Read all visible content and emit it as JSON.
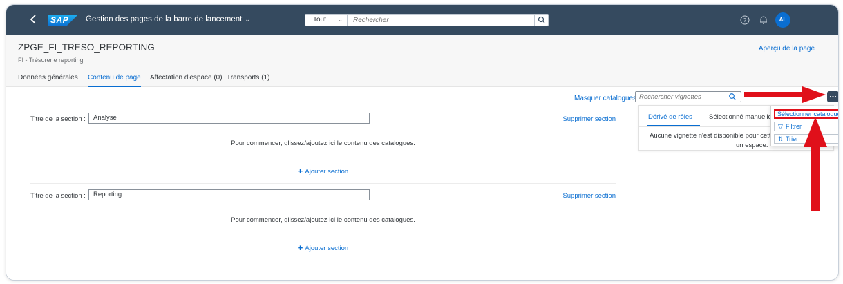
{
  "shell": {
    "logo_text": "SAP",
    "app_title": "Gestion des pages de la barre de lancement",
    "search_scope": "Tout",
    "search_placeholder": "Rechercher",
    "avatar_initials": "AL"
  },
  "header": {
    "title": "ZPGE_FI_TRESO_REPORTING",
    "subtitle": "FI - Trésorerie reporting",
    "preview_link": "Aperçu de la page",
    "tabs": [
      {
        "label": "Données générales"
      },
      {
        "label": "Contenu de page"
      },
      {
        "label": "Affectation d'espace (0)"
      },
      {
        "label": "Transports (1)"
      }
    ]
  },
  "toolbar": {
    "hide_catalogs": "Masquer catalogues",
    "tile_search_placeholder": "Rechercher vignettes"
  },
  "sections": [
    {
      "label": "Titre de la section :",
      "title_value": "Analyse",
      "delete": "Supprimer section",
      "hint": "Pour commencer, glissez/ajoutez ici le contenu des catalogues.",
      "add": "Ajouter section"
    },
    {
      "label": "Titre de la section :",
      "title_value": "Reporting",
      "delete": "Supprimer section",
      "hint": "Pour commencer, glissez/ajoutez ici le contenu des catalogues.",
      "add": "Ajouter section"
    }
  ],
  "side_panel": {
    "tabs": [
      {
        "label": "Dérivé de rôles"
      },
      {
        "label": "Sélectionné manuellem"
      }
    ],
    "message_line1": "Aucune vignette n'est disponible pour cette pa",
    "message_line2": "un espace."
  },
  "menu": {
    "items": [
      {
        "label": "Sélectionner catalogues"
      },
      {
        "label": "Filtrer"
      },
      {
        "label": "Trier"
      }
    ]
  },
  "colors": {
    "shell": "#354a5f",
    "link": "#0a6ed1",
    "annotation": "#e0101a"
  }
}
